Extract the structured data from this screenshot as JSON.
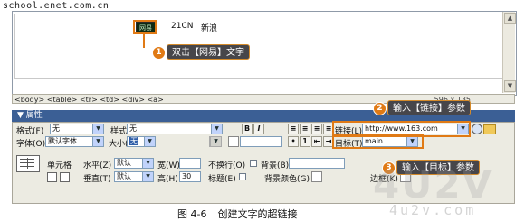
{
  "watermark_top": "school.enet.com.cn",
  "document": {
    "selected_text": "网易",
    "link_text": "21CN",
    "news_text": "新浪"
  },
  "tag_selector": {
    "path": "<body> <table> <tr> <td> <div> <a>",
    "size_info": "596 x 135"
  },
  "properties": {
    "title": "▼ 属性",
    "format_label": "格式(F)",
    "format_value": "无",
    "style_label": "样式(S)",
    "style_value": "无",
    "bold_label": "B",
    "italic_label": "I",
    "link_label": "链接(L)",
    "link_value": "http://www.163.com",
    "font_label": "字体(O)",
    "font_value": "默认字体",
    "size_label": "大小(S)",
    "size_value": "无",
    "target_label": "目标(T)",
    "target_value": "main",
    "cell_label": "单元格",
    "horz_label": "水平(Z)",
    "horz_value": "默认",
    "width_label": "宽(W)",
    "nowrap_label": "不换行(O)",
    "bg_label": "背景(B)",
    "vert_label": "垂直(T)",
    "vert_value": "默认",
    "height_label": "高(H)",
    "height_value": "30",
    "header_label": "标题(E)",
    "bgcolor_label": "背景颜色(G)",
    "border_label": "边框(K)"
  },
  "callouts": {
    "c1": {
      "num": "1",
      "text": "双击【网易】文字"
    },
    "c2": {
      "num": "2",
      "text": "输入【链接】参数"
    },
    "c3": {
      "num": "3",
      "text": "输入【目标】参数"
    }
  },
  "caption": {
    "figure": "图 4-6",
    "text": "创建文字的超链接"
  },
  "watermark_big": "4U2V",
  "watermark_small": "4u2v.com",
  "colors": {
    "panel_header": "#3b5f95",
    "callout_accent": "#e07a15",
    "callout_bg": "#47464a"
  }
}
